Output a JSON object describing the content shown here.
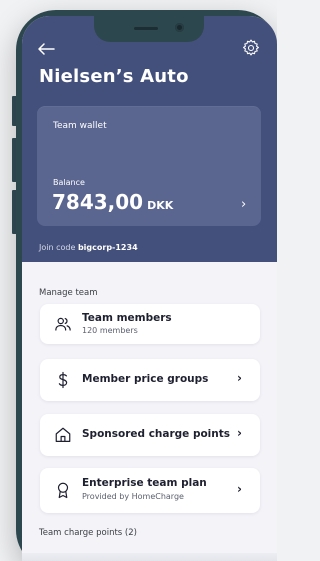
{
  "header": {
    "team_name": "Nielsen’s Auto",
    "back_icon": "arrow-left-icon",
    "settings_icon": "gear-icon"
  },
  "wallet": {
    "label": "Team wallet",
    "balance_label": "Balance",
    "balance_amount": "7843,00",
    "currency": "DKK",
    "chevron": "›"
  },
  "join": {
    "prefix": "Join code",
    "code": "bigcorp-1234"
  },
  "manage": {
    "section_label": "Manage team",
    "items": [
      {
        "title": "Team members",
        "subtitle": "120 members",
        "icon": "users-icon"
      },
      {
        "title": "Member price groups",
        "icon": "dollar-icon",
        "chevron": "›"
      },
      {
        "title": "Sponsored charge points",
        "icon": "home-icon",
        "chevron": "›"
      },
      {
        "title": "Enterprise team plan",
        "subtitle": "Provided by HomeCharge",
        "icon": "award-icon",
        "chevron": "›"
      }
    ]
  },
  "charge_points": {
    "section_label": "Team charge points (2)"
  },
  "colors": {
    "hero": "#44507c",
    "card": "#5a6690",
    "phone_frame": "#2d474f",
    "screen_bg": "#f3f3f8"
  }
}
